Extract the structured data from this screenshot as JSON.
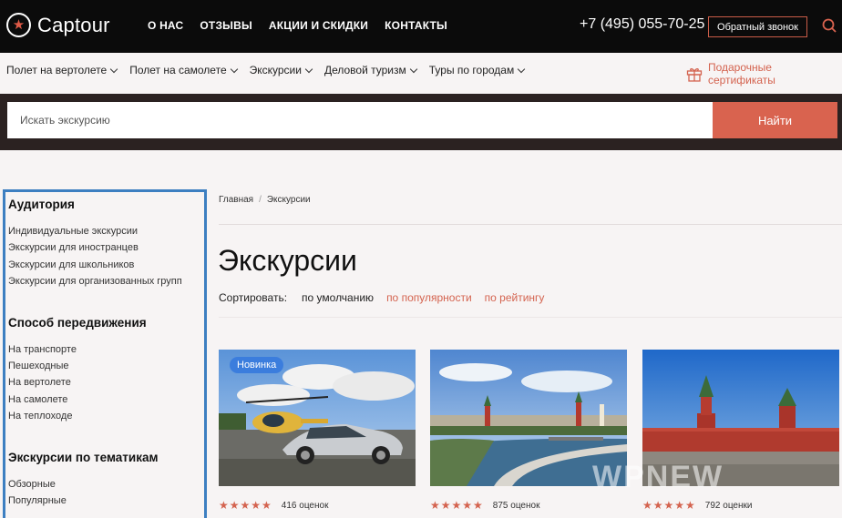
{
  "header": {
    "logo_text": "Captour",
    "nav": [
      "О НАС",
      "ОТЗЫВЫ",
      "АКЦИИ И СКИДКИ",
      "КОНТАКТЫ"
    ],
    "phone": "+7 (495) 055-70-25",
    "callback_label": "Обратный звонок"
  },
  "menu": {
    "items": [
      "Полет на вертолете",
      "Полет на самолете",
      "Экскурсии",
      "Деловой туризм",
      "Туры по городам"
    ],
    "gift_label": "Подарочные сертификаты"
  },
  "search": {
    "placeholder": "Искать экскурсию",
    "button_label": "Найти"
  },
  "sidebar": {
    "groups": [
      {
        "title": "Аудитория",
        "items": [
          "Индивидуальные экскурсии",
          "Экскурсии для иностранцев",
          "Экскурсии для школьников",
          "Экскурсии для организованных групп"
        ]
      },
      {
        "title": "Способ передвижения",
        "items": [
          "На транспорте",
          "Пешеходные",
          "На вертолете",
          "На самолете",
          "На теплоходе"
        ]
      },
      {
        "title": "Экскурсии по тематикам",
        "items": [
          "Обзорные",
          "Популярные"
        ]
      }
    ]
  },
  "breadcrumb": {
    "home": "Главная",
    "sep": "/",
    "current": "Экскурсии"
  },
  "page_title": "Экскурсии",
  "sort": {
    "label": "Сортировать:",
    "options": [
      "по умолчанию",
      "по популярности",
      "по рейтингу"
    ]
  },
  "cards": [
    {
      "badge": "Новинка",
      "stars": "★★★★★",
      "reviews": "416 оценок"
    },
    {
      "badge": "",
      "stars": "★★★★★",
      "reviews": "875 оценок"
    },
    {
      "badge": "",
      "stars": "★★★★★",
      "reviews": "792 оценки"
    }
  ],
  "watermark": "WPNEW",
  "colors": {
    "accent": "#d9634f",
    "dark": "#0b0b0b",
    "highlight": "#3d7fc1",
    "badge": "#3b7ddd"
  },
  "icons": [
    "logo-star-icon",
    "search-icon",
    "chevron-down-icon",
    "gift-icon"
  ]
}
